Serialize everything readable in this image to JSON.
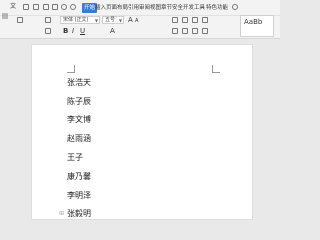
{
  "ribbon": {
    "file_label": "文",
    "tabs": [
      "开始",
      "插入",
      "页面布局",
      "引用",
      "审阅",
      "视图",
      "章节",
      "安全",
      "开发工具",
      "特色功能"
    ],
    "active_tab_index": 0,
    "font_name": "宋体 (正文)",
    "font_size": "五号",
    "style_preview": "AaBb"
  },
  "document": {
    "lines": [
      "张浩天",
      "陈子辰",
      "李文博",
      "赵雨涵",
      "王子",
      "康乃馨",
      "李明泽",
      "张毅明"
    ]
  },
  "colors": {
    "accent": "#3a7bd5",
    "page": "#ffffff",
    "background": "#e9e9e9"
  }
}
